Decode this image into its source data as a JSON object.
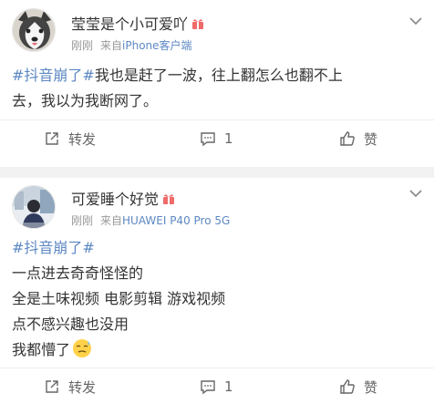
{
  "posts": [
    {
      "user": "莹莹是个小可爱吖",
      "time": "刚刚",
      "from_prefix": "来自",
      "source": "iPhone客户端",
      "topic": "#抖音崩了#",
      "lines": [
        "我也是赶了一波，往上翻怎么也翻不上",
        "去，我以为我断网了。"
      ],
      "repost_label": "转发",
      "comment_count": "1",
      "like_label": "赞"
    },
    {
      "user": "可爱睡个好觉",
      "time": "刚刚",
      "from_prefix": "来自",
      "source": "HUAWEI P40 Pro 5G",
      "topic": "#抖音崩了#",
      "lines": [
        "一点进去奇奇怪怪的",
        "全是土味视频 电影剪辑 游戏视频",
        "点不感兴趣也没用",
        "我都懵了"
      ],
      "repost_label": "转发",
      "comment_count": "1",
      "like_label": "赞"
    }
  ],
  "colors": {
    "link": "#5d88c3",
    "meta": "#999999",
    "divider": "#f2f2f2"
  },
  "icons": [
    "husky-avatar",
    "person-avatar",
    "gift-badge-icon",
    "more-chevron-icon",
    "repost-icon",
    "comment-icon",
    "like-icon",
    "emoji-sweat-icon"
  ]
}
